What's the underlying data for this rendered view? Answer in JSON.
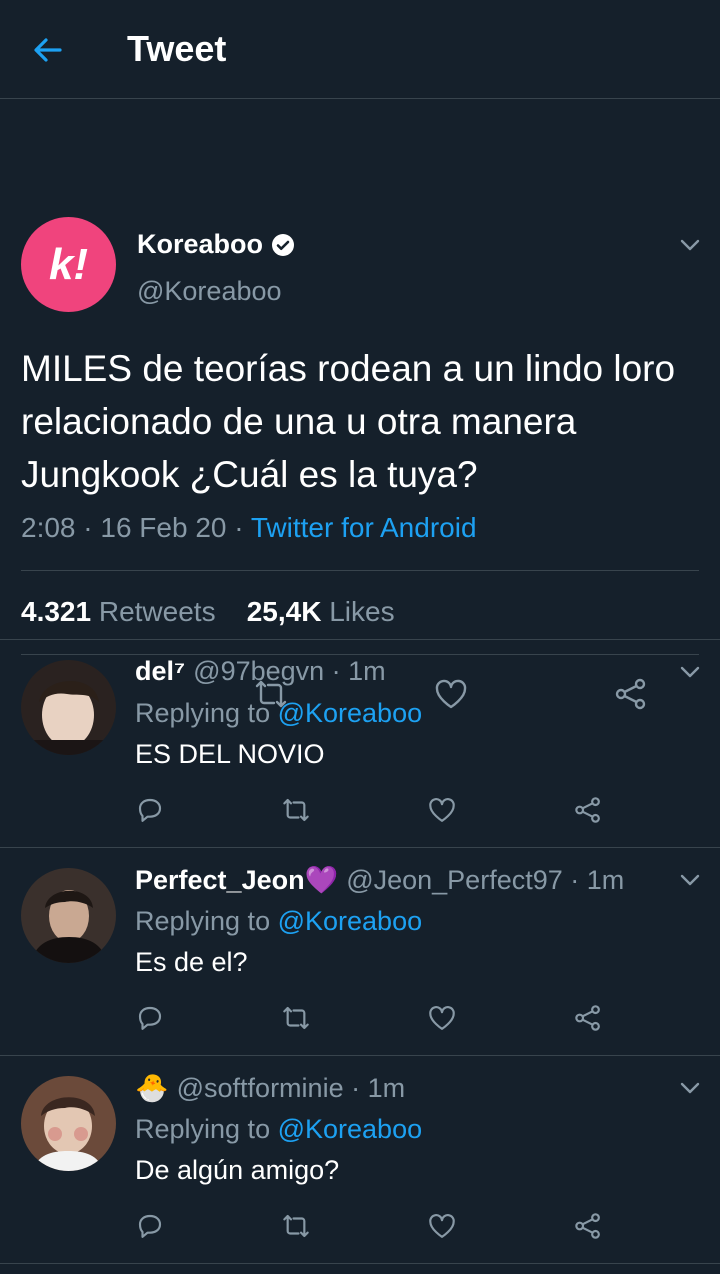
{
  "header": {
    "title": "Tweet"
  },
  "tweet": {
    "author_name": "Koreaboo",
    "author_handle": "@Koreaboo",
    "avatar_letter": "k!",
    "text": "MILES de teorías rodean a un lindo loro relacionado de una u otra manera Jungkook ¿Cuál es la tuya?",
    "time": "2:08 · 16 Feb 20 · ",
    "source": "Twitter for Android",
    "retweets_count": "4.321",
    "retweets_label": " Retweets",
    "likes_count": "25,4K",
    "likes_label": " Likes"
  },
  "replies": [
    {
      "name": "del⁷",
      "handle": "@97begvn · 1m",
      "replying_prefix": "Replying to ",
      "replying_to": "@Koreaboo",
      "text": "ES DEL NOVIO"
    },
    {
      "name": "Perfect_Jeon💜",
      "handle": "@Jeon_Perfect97 · 1m",
      "replying_prefix": "Replying to ",
      "replying_to": "@Koreaboo",
      "text": "Es de el?"
    },
    {
      "name": "🐣",
      "handle": "@softforminie · 1m",
      "replying_prefix": "Replying to ",
      "replying_to": "@Koreaboo",
      "text": "De algún amigo?"
    }
  ],
  "colors": {
    "background": "#15202b",
    "accent": "#1da1f2",
    "muted": "#8899a6",
    "brand": "#f0447d"
  }
}
